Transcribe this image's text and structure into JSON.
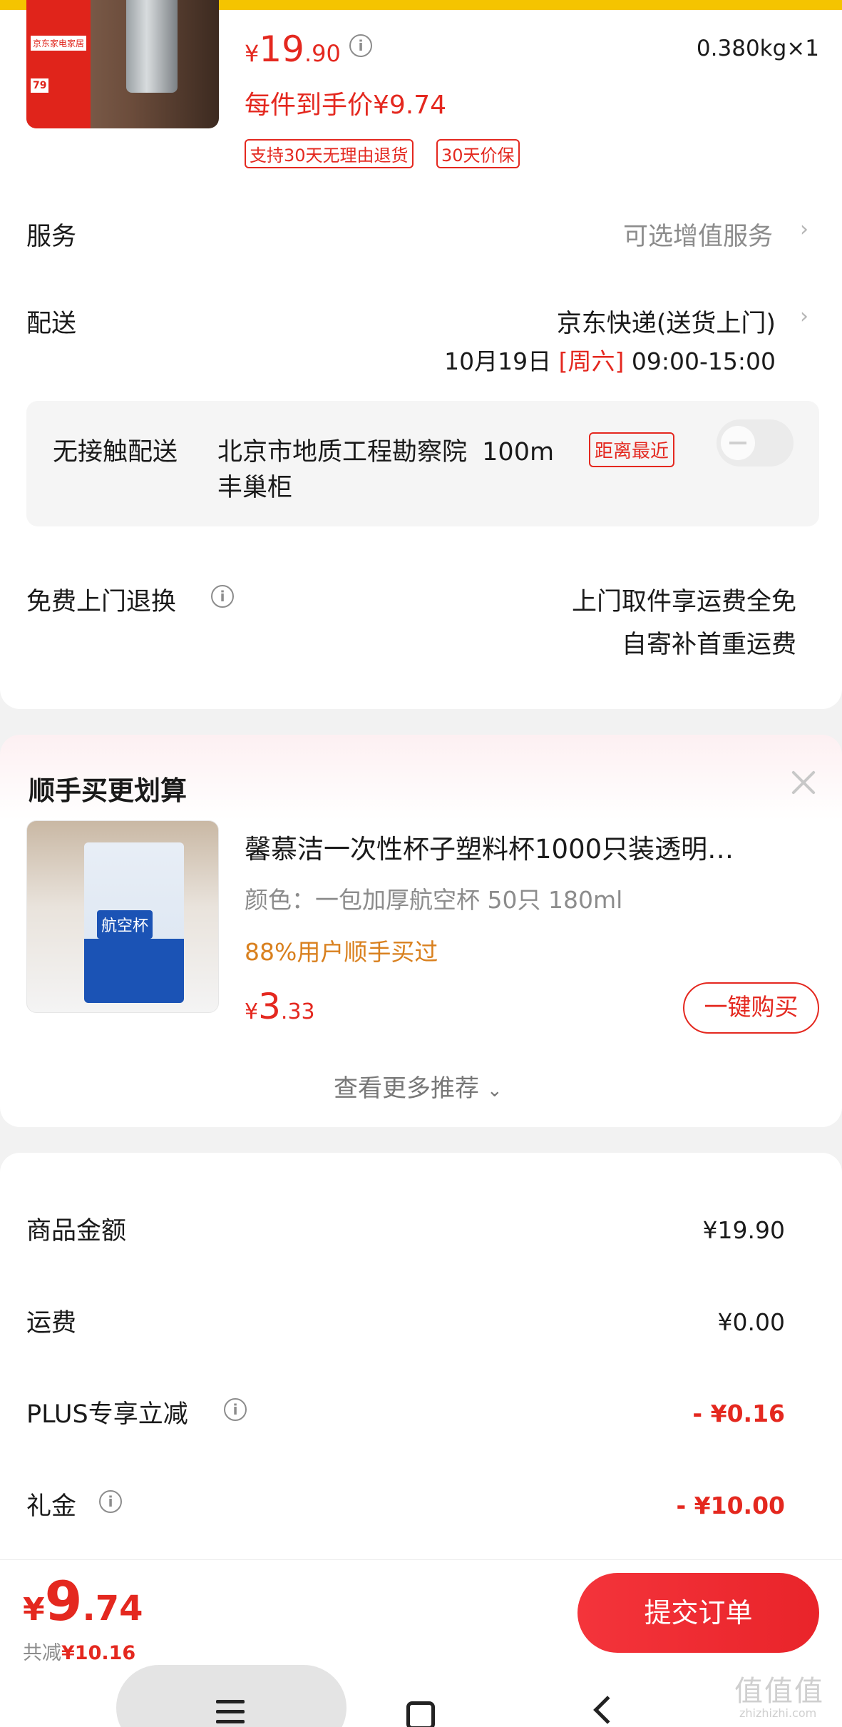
{
  "product": {
    "price_symbol": "¥",
    "price_int": "19",
    "price_dec": ".90",
    "weight_qty": "0.380kg×1",
    "per_item_price": "每件到手价¥9.74",
    "tags": [
      "支持30天无理由退货",
      "30天价保"
    ],
    "image_badges": [
      "京东家电家居",
      "79"
    ]
  },
  "service": {
    "label": "服务",
    "value": "可选增值服务"
  },
  "delivery": {
    "label": "配送",
    "method": "京东快递(送货上门)",
    "date": "10月19日",
    "weekday": "[周六]",
    "time": "09:00-15:00"
  },
  "contactless": {
    "label": "无接触配送",
    "location_line1": "北京市地质工程勘察院",
    "distance": "100m",
    "nearest_tag": "距离最近",
    "location_line2": "丰巢柜"
  },
  "free_return": {
    "label": "免费上门退换",
    "line1": "上门取件享运费全免",
    "line2": "自寄补首重运费"
  },
  "recommend": {
    "title": "顺手买更划算",
    "item_title": "馨慕洁一次性杯子塑料杯1000只装透明…",
    "item_spec": "颜色：一包加厚航空杯 50只 180ml",
    "item_stat": "88%用户顺手买过",
    "price_symbol": "¥",
    "price_int": "3",
    "price_dec": ".33",
    "buy_label": "一键购买",
    "more_label": "查看更多推荐",
    "image_text": "航空杯"
  },
  "summary": {
    "rows": [
      {
        "label": "商品金额",
        "value": "¥19.90"
      },
      {
        "label": "运费",
        "value": "¥0.00"
      },
      {
        "label": "PLUS专享立减",
        "value": "- ¥0.16"
      },
      {
        "label": "礼金",
        "value": "- ¥10.00"
      }
    ]
  },
  "bottom": {
    "price_symbol": "¥",
    "price_int": "9",
    "price_dec": ".74",
    "saved_label": "共减",
    "saved_value": "¥10.16",
    "submit_label": "提交订单"
  },
  "watermark": {
    "main": "值值值",
    "sub": "zhizhizhi.com"
  },
  "colors": {
    "accent": "#e4281f",
    "topbar": "#f5c400",
    "stat": "#d9801e"
  }
}
